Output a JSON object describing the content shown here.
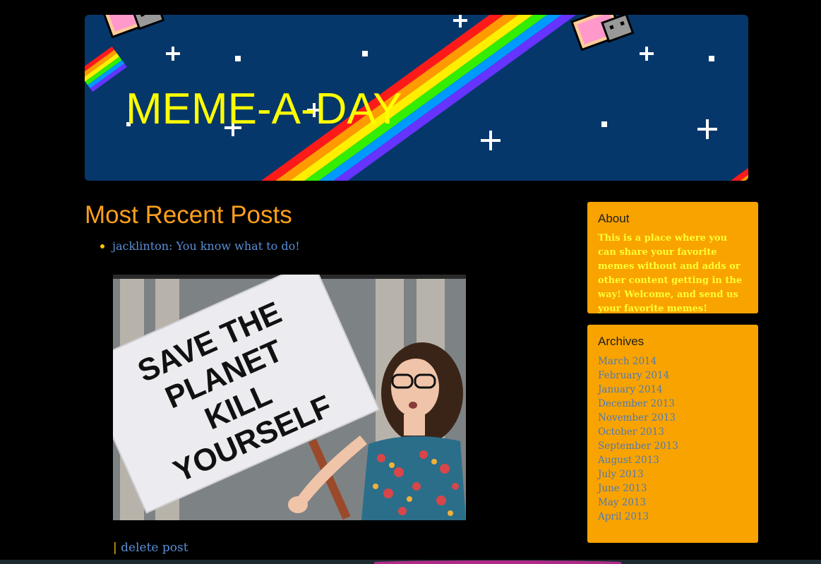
{
  "header": {
    "title": "MEME-A-DAY"
  },
  "main": {
    "section_title": "Most Recent Posts",
    "posts": [
      {
        "link_text": "jacklinton: You know what to do!",
        "image_sign_text": [
          "SAVE THE",
          "PLANET",
          "KILL",
          "YOURSELF"
        ],
        "separator": "|",
        "delete_label": "delete post"
      }
    ]
  },
  "sidebar": {
    "about": {
      "title": "About",
      "text": "This is a place where you can share your favorite memes without and adds or other content getting in the way! Welcome, and send us your favorite memes!"
    },
    "archives": {
      "title": "Archives",
      "items": [
        "March 2014",
        "February 2014",
        "January 2014",
        "December 2013",
        "November 2013",
        "October 2013",
        "September 2013",
        "August 2013",
        "July 2013",
        "June 2013",
        "May 2013",
        "April 2013"
      ]
    }
  },
  "colors": {
    "background": "#000000",
    "banner": "#06376a",
    "title_yellow": "#ffff00",
    "section_orange": "#ff9f1c",
    "sidebar_orange": "#f9a300",
    "link_blue": "#5a8fd8"
  }
}
